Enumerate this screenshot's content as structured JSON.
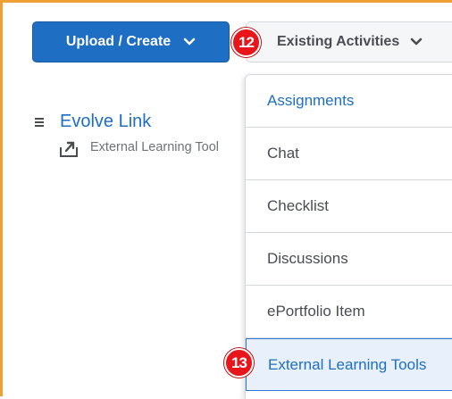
{
  "toolbar": {
    "upload_label": "Upload / Create",
    "existing_label": "Existing Activities"
  },
  "badges": {
    "step_a": "12",
    "step_b": "13"
  },
  "content_item": {
    "title": "Evolve Link",
    "subtitle": "External Learning Tool",
    "icon": "external-tool-icon"
  },
  "menu": {
    "items": [
      {
        "label": "Assignments"
      },
      {
        "label": "Chat"
      },
      {
        "label": "Checklist"
      },
      {
        "label": "Discussions"
      },
      {
        "label": "ePortfolio Item"
      },
      {
        "label": "External Learning Tools"
      }
    ],
    "active_index": 5
  },
  "colors": {
    "primary": "#1e6ec3",
    "frame": "#f0a030",
    "badge": "#e8151b",
    "active_bg": "#e8f1fb"
  }
}
